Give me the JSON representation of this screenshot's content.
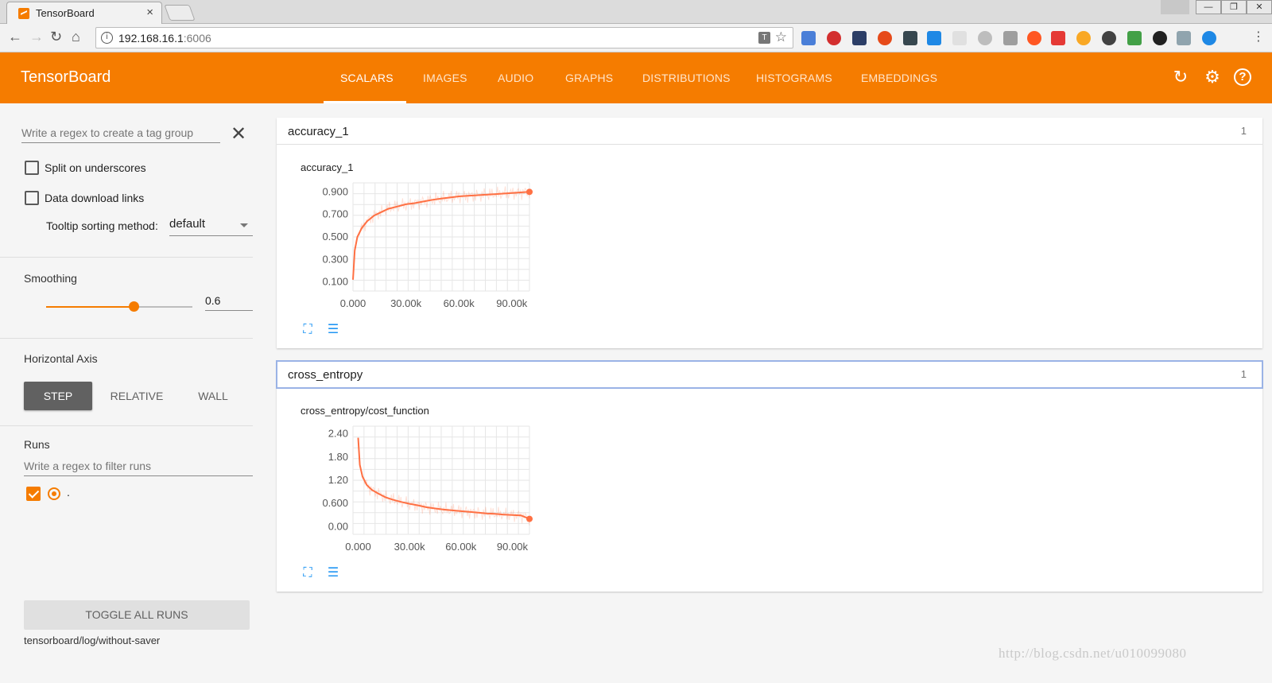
{
  "browser": {
    "tab_title": "TensorBoard",
    "tab_close": "×",
    "url_host": "192.168.16.1",
    "url_port": ":6006",
    "window_controls": [
      "—",
      "❐",
      "✕"
    ]
  },
  "header": {
    "brand": "TensorBoard",
    "tabs": [
      "SCALARS",
      "IMAGES",
      "AUDIO",
      "GRAPHS",
      "DISTRIBUTIONS",
      "HISTOGRAMS",
      "EMBEDDINGS"
    ],
    "active_tab": "SCALARS",
    "accent": "#f57c00"
  },
  "sidebar": {
    "tag_regex_placeholder": "Write a regex to create a tag group",
    "split_label": "Split on underscores",
    "split_checked": false,
    "download_label": "Data download links",
    "download_checked": false,
    "tooltip_label": "Tooltip sorting method:",
    "tooltip_value": "default",
    "smoothing_title": "Smoothing",
    "smoothing_value": 0.6,
    "smoothing_text": "0.6",
    "axis_title": "Horizontal Axis",
    "axis_options": [
      "STEP",
      "RELATIVE",
      "WALL"
    ],
    "axis_active": "STEP",
    "runs_title": "Runs",
    "runs_placeholder": "Write a regex to filter runs",
    "runs": [
      {
        "name": ".",
        "checked": true,
        "color": "#f57c00"
      }
    ],
    "toggle_label": "TOGGLE ALL RUNS",
    "logdir": "tensorboard/log/without-saver"
  },
  "categories": [
    {
      "name": "accuracy_1",
      "count": "1",
      "card_title": "accuracy_1"
    },
    {
      "name": "cross_entropy",
      "count": "1",
      "card_title": "cross_entropy/cost_function"
    }
  ],
  "chart_data": [
    {
      "type": "line",
      "title": "accuracy_1",
      "x_ticks": [
        "0.000",
        "30.00k",
        "60.00k",
        "90.00k"
      ],
      "y_ticks": [
        "0.900",
        "0.700",
        "0.500",
        "0.300",
        "0.100"
      ],
      "xlim": [
        0,
        100000
      ],
      "ylim": [
        0.02,
        0.98
      ],
      "grid": true,
      "series": [
        {
          "color": "#ff7043",
          "x": [
            0,
            1000,
            2500,
            5000,
            8000,
            12000,
            16000,
            20000,
            25000,
            30000,
            35000,
            40000,
            45000,
            50000,
            55000,
            60000,
            65000,
            70000,
            75000,
            80000,
            85000,
            90000,
            95000,
            100000
          ],
          "y": [
            0.12,
            0.38,
            0.5,
            0.58,
            0.64,
            0.69,
            0.72,
            0.75,
            0.77,
            0.79,
            0.8,
            0.815,
            0.83,
            0.84,
            0.85,
            0.86,
            0.865,
            0.87,
            0.875,
            0.88,
            0.885,
            0.89,
            0.895,
            0.9
          ]
        }
      ]
    },
    {
      "type": "line",
      "title": "cross_entropy/cost_function",
      "x_ticks": [
        "0.000",
        "30.00k",
        "60.00k",
        "90.00k"
      ],
      "y_ticks": [
        "2.40",
        "1.80",
        "1.20",
        "0.600",
        "0.00"
      ],
      "xlim": [
        -3000,
        100000
      ],
      "ylim": [
        -0.2,
        2.6
      ],
      "grid": true,
      "series": [
        {
          "color": "#ff7043",
          "x": [
            0,
            1000,
            2500,
            5000,
            8000,
            12000,
            16000,
            20000,
            25000,
            30000,
            35000,
            40000,
            45000,
            50000,
            55000,
            60000,
            65000,
            70000,
            75000,
            80000,
            85000,
            90000,
            95000,
            100000
          ],
          "y": [
            2.3,
            1.6,
            1.3,
            1.08,
            0.95,
            0.85,
            0.76,
            0.7,
            0.64,
            0.59,
            0.55,
            0.5,
            0.47,
            0.44,
            0.42,
            0.4,
            0.38,
            0.36,
            0.34,
            0.33,
            0.31,
            0.3,
            0.29,
            0.2
          ]
        }
      ]
    }
  ],
  "watermark": "http://blog.csdn.net/u010099080"
}
